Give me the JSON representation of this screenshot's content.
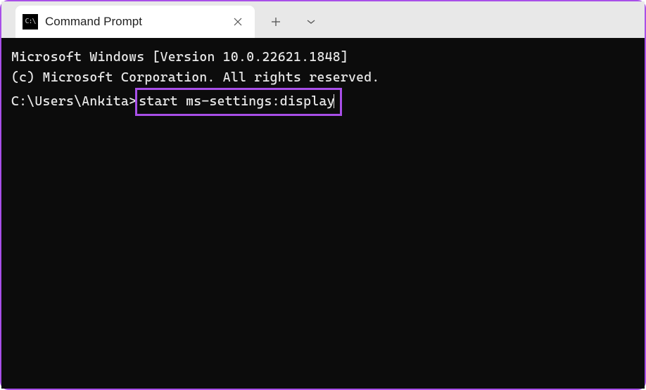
{
  "tabbar": {
    "active_tab": {
      "title": "Command Prompt",
      "icon_glyph": "C:\\"
    },
    "new_tab_glyph": "+",
    "dropdown_glyph": "⌄",
    "close_glyph": "✕"
  },
  "terminal": {
    "line1": "Microsoft Windows [Version 10.0.22621.1848]",
    "line2": "(c) Microsoft Corporation. All rights reserved.",
    "blank": "",
    "prompt": "C:\\Users\\Ankita>",
    "command": "start ms-settings:display"
  },
  "highlight_color": "#a84fe8"
}
